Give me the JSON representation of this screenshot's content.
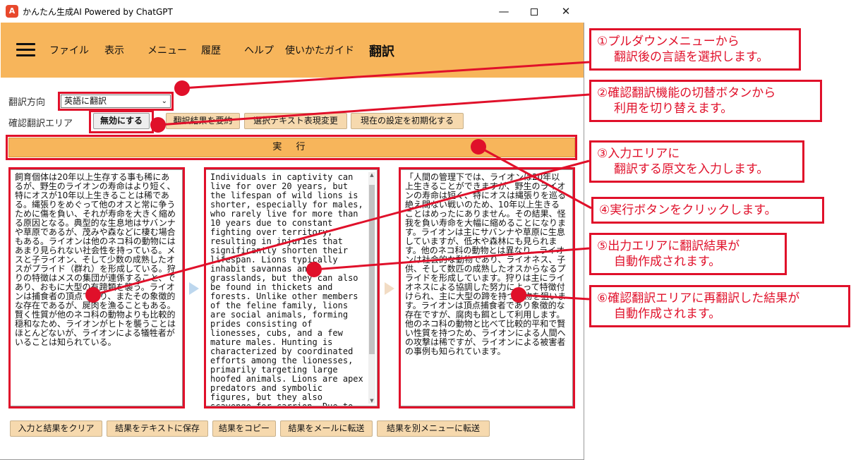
{
  "window": {
    "title": "かんたん生成AI Powered by ChatGPT",
    "icon_glyph": "A",
    "minimize": "—",
    "close": "✕"
  },
  "menubar": {
    "items": [
      "ファイル",
      "表示",
      "メニュー",
      "履歴",
      "ヘルプ",
      "使いかたガイド"
    ],
    "page_title": "翻訳"
  },
  "form": {
    "direction_label": "翻訳方向",
    "direction_selected": "英語に翻訳",
    "confirm_label": "確認翻訳エリア",
    "buttons": [
      "無効にする",
      "翻訳結果を要約",
      "選択テキスト表現変更",
      "現在の設定を初期化する"
    ],
    "execute": "実 行"
  },
  "areas": {
    "input": "飼育個体は20年以上生存する事も稀にあるが、野生のライオンの寿命はより短く、特にオスが10年以上生きることは稀である。縄張りをめぐって他のオスと常に争うために傷を負い、それが寿命を大きく縮める原因となる。典型的な生息地はサバンナや草原であるが、茂みや森などに棲む場合もある。ライオンは他のネコ科の動物にはあまり見られない社会性を持っている。メスと子ライオン、そして少数の成熟したオスがプライド（群れ）を形成している。狩りの特徴はメスの集団が連係すること、であり、おもに大型の有蹄類を襲う。ライオンは捕食者の頂点であり、またその象徴的な存在であるが、屍肉を漁ることもある。賢く性質が他のネコ科の動物よりも比較的穏和なため、ライオンがヒトを襲うことはほとんどないが、ライオンによる犠牲者がいることは知られている。",
    "output": "Individuals in captivity can live for over 20 years, but the lifespan of wild lions is shorter, especially for males, who rarely live for more than 10 years due to constant fighting over territory, resulting in injuries that significantly shorten their lifespan. Lions typically inhabit savannas and grasslands, but they can also be found in thickets and forests. Unlike other members of the feline family, lions are social animals, forming prides consisting of lionesses, cubs, and a few mature males. Hunting is characterized by coordinated efforts among the lionesses, primarily targeting large hoofed animals. Lions are apex predators and symbolic figures, but they also scavenge for carrion. Due to",
    "confirm": "「人間の管理下では、ライオンは20年以上生きることができますが、野生のライオンの寿命は短く、特にオスは縄張りを巡る絶え間ない戦いのため、10年以上生きることはめったにありません。その結果、怪我を負い寿命を大幅に縮めることになります。ライオンは主にサバンナや草原に生息していますが、低木や森林にも見られます。他のネコ科の動物とは異なり、ライオンは社会的な動物であり、ライオネス、子供、そして数匹の成熟したオスからなるプライドを形成しています。狩りは主にライオネスによる協調した努力によって特徴付けられ、主に大型の蹄を持つ動物を狙います。ライオンは頂点捕食者であり象徴的な存在ですが、腐肉も餌として利用します。他のネコ科の動物と比べて比較的平和で賢い性質を持つため、ライオンによる人間への攻撃は稀ですが、ライオンによる被害者の事例も知られています。"
  },
  "bottom_buttons": [
    "入力と結果をクリア",
    "結果をテキストに保存",
    "結果をコピー",
    "結果をメールに転送",
    "結果を別メニューに転送"
  ],
  "annotations": {
    "c1": [
      "①プルダウンメニューから",
      "翻訳後の言語を選択します。"
    ],
    "c2": [
      "②確認翻訳機能の切替ボタンから",
      "利用を切り替えます。"
    ],
    "c3": [
      "③入力エリアに",
      "翻訳する原文を入力します。"
    ],
    "c4": [
      "④実行ボタンをクリックします。"
    ],
    "c5": [
      "⑤出力エリアに翻訳結果が",
      "自動作成されます。"
    ],
    "c6": [
      "⑥確認翻訳エリアに再翻訳した結果が",
      "自動作成されます。"
    ]
  },
  "colors": {
    "accent_orange": "#f7b55b",
    "annotation_red": "#e0102a",
    "button_tan": "#f6d9ae"
  }
}
